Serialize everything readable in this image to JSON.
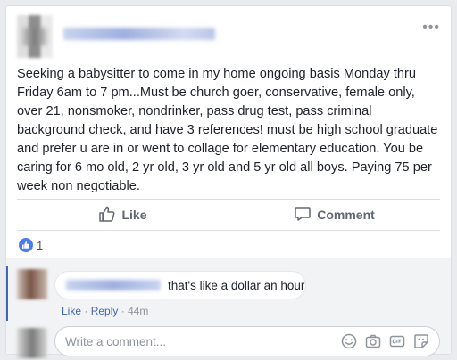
{
  "post": {
    "text": "Seeking a babysitter to come in my home ongoing basis Monday thru Friday 6am to 7 pm...Must be church goer, conservative, female only, over 21, nonsmoker, nondrinker, pass drug test, pass criminal background check, and have 3 references! must be high school graduate and prefer u are in or went to collage for elementary education. You be caring for 6 mo old, 2 yr old, 3 yr old and 5 yr old all boys. Paying 75 per week non negotiable.",
    "more_icon": "more-options-icon"
  },
  "actions": {
    "like_label": "Like",
    "comment_label": "Comment"
  },
  "reactions": {
    "like_count": "1"
  },
  "comment": {
    "text": "that's like a dollar an hour",
    "like_link": "Like",
    "separator": "·",
    "reply_link": "Reply",
    "time": "44m"
  },
  "composer": {
    "placeholder": "Write a comment...",
    "icons": [
      "emoji-icon",
      "camera-icon",
      "gif-icon",
      "sticker-icon"
    ]
  },
  "colors": {
    "accent": "#4267b2",
    "like_badge": "#4a7cf0",
    "muted_text": "#606770"
  }
}
